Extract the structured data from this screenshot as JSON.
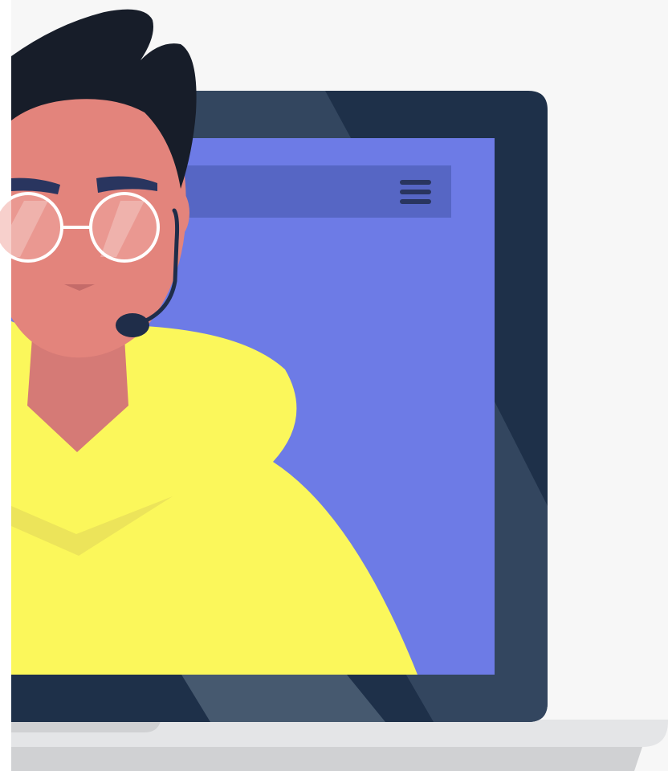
{
  "illustration": {
    "subject": "support-agent-with-headset-on-laptop-screen",
    "icons": [
      "menu-icon",
      "headset-icon",
      "glasses-icon",
      "laptop-icon"
    ]
  },
  "colors": {
    "background": "#f7f7f7",
    "laptop_frame": "#1e3049",
    "laptop_frame_light": "#33465f",
    "screen": "#6d7be6",
    "menu_bar": "#5666c4",
    "menu_lines": "#29355f",
    "skin": "#e3847c",
    "skin_shadow": "#d57a76",
    "hair": "#171d29",
    "hoodie": "#fbf75b",
    "hoodie_shadow": "#ece45a",
    "glasses_frame": "#ffffff",
    "headset": "#1f2d49",
    "base_top": "#e4e5e7",
    "base_bottom": "#d0d1d3"
  }
}
